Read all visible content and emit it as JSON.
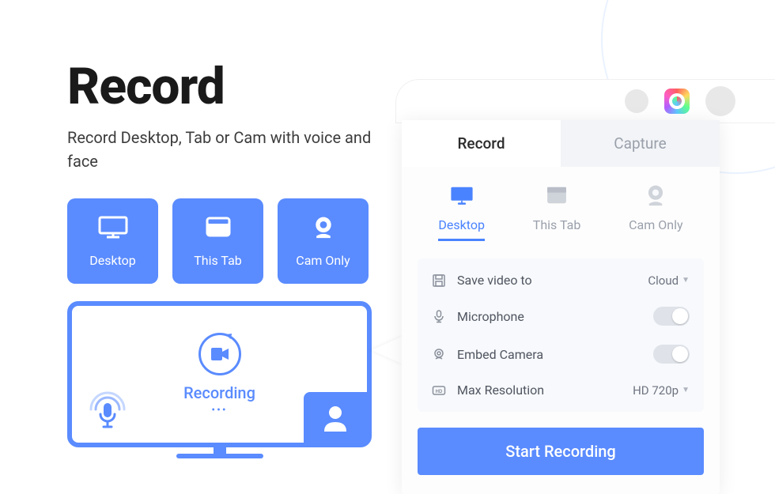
{
  "hero": {
    "title": "Record",
    "subtitle": "Record Desktop, Tab or Cam with voice and face"
  },
  "hero_modes": [
    {
      "label": "Desktop"
    },
    {
      "label": "This Tab"
    },
    {
      "label": "Cam Only"
    }
  ],
  "preview": {
    "status_label": "Recording",
    "dots": "•••"
  },
  "panel": {
    "tabs": {
      "record": "Record",
      "capture": "Capture"
    },
    "sources": [
      {
        "label": "Desktop"
      },
      {
        "label": "This Tab"
      },
      {
        "label": "Cam Only"
      }
    ],
    "settings": {
      "save_to": {
        "label": "Save video to",
        "value": "Cloud"
      },
      "microphone": {
        "label": "Microphone"
      },
      "embed_camera": {
        "label": "Embed Camera"
      },
      "max_resolution": {
        "label": "Max Resolution",
        "value": "HD 720p"
      }
    },
    "start_button": "Start Recording"
  }
}
